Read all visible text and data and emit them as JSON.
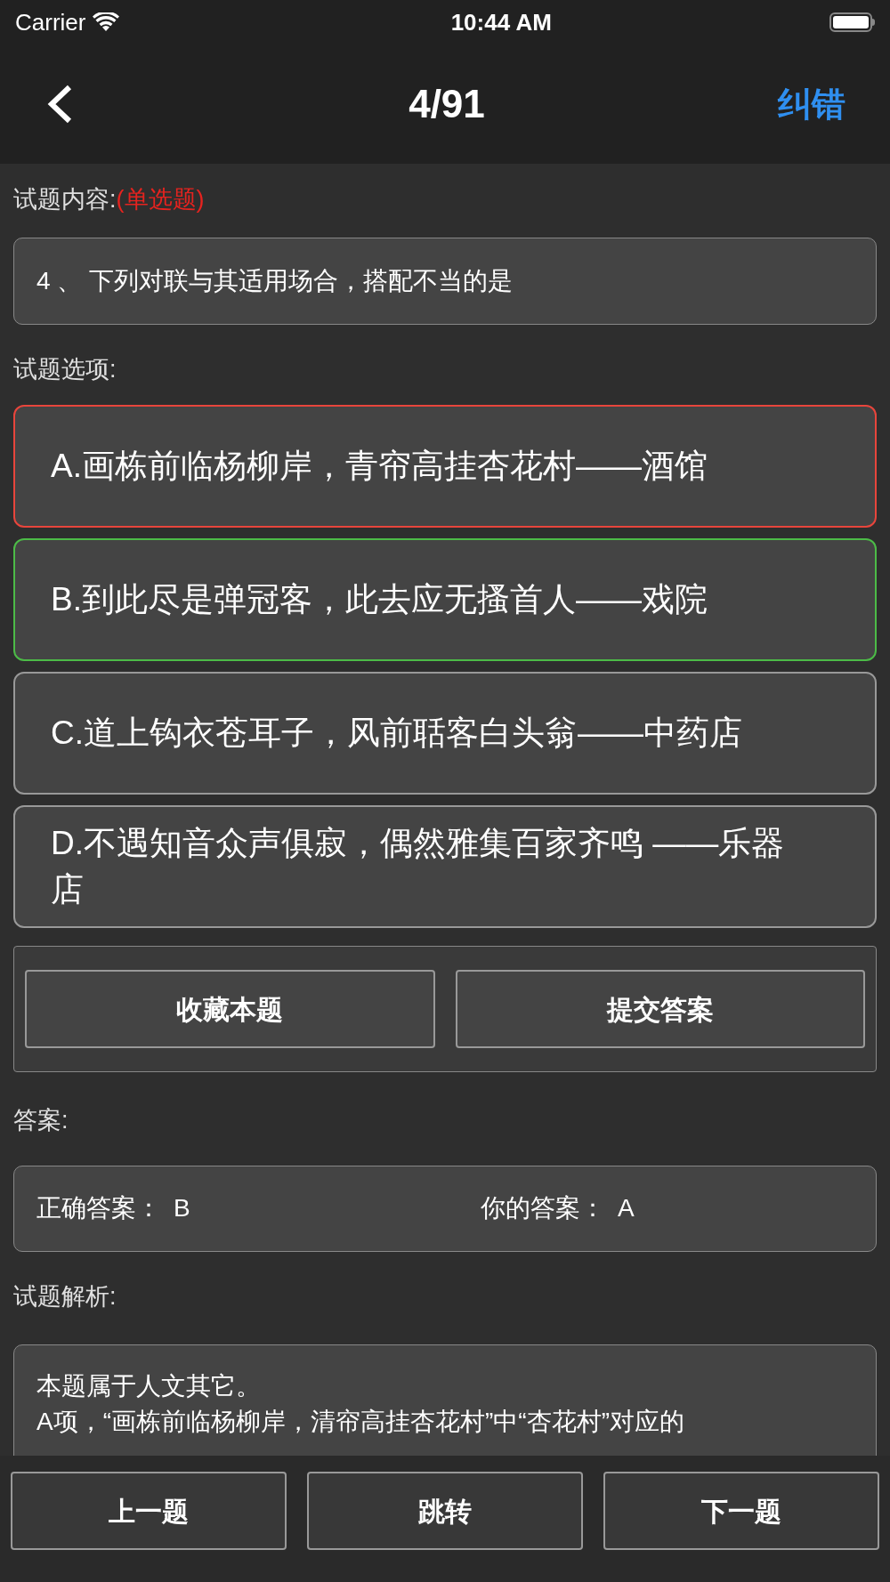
{
  "status_bar": {
    "carrier": "Carrier",
    "time": "10:44 AM"
  },
  "nav": {
    "title": "4/91",
    "action": "纠错"
  },
  "question_label": "试题内容:",
  "question_type": "(单选题)",
  "question": "4 、 下列对联与其适用场合，搭配不当的是",
  "options_label": "试题选项:",
  "options": [
    {
      "text": "A.画栋前临杨柳岸，青帘高挂杏花村——酒馆",
      "color": "#e8453c"
    },
    {
      "text": "B.到此尽是弹冠客，此去应无搔首人——戏院",
      "color": "#4cbb47"
    },
    {
      "text": "C.道上钩衣苍耳子，风前聒客白头翁——中药店",
      "color": "#999999"
    },
    {
      "text": "D.不遇知音众声俱寂，偶然雅集百家齐鸣 ——乐器店",
      "color": "#999999"
    }
  ],
  "actions": [
    "收藏本题",
    "提交答案"
  ],
  "answer_label": "答案:",
  "answer": {
    "correct_label": "正确答案：",
    "correct": "B",
    "yours_label": "你的答案：",
    "yours": "A"
  },
  "analysis_label": "试题解析:",
  "analysis": [
    "本题属于人文其它。",
    "A项，“画栋前临杨柳岸，清帘高挂杏花村”中“杏花村”对应的"
  ],
  "bottom_buttons": [
    "上一题",
    "跳转",
    "下一题"
  ]
}
